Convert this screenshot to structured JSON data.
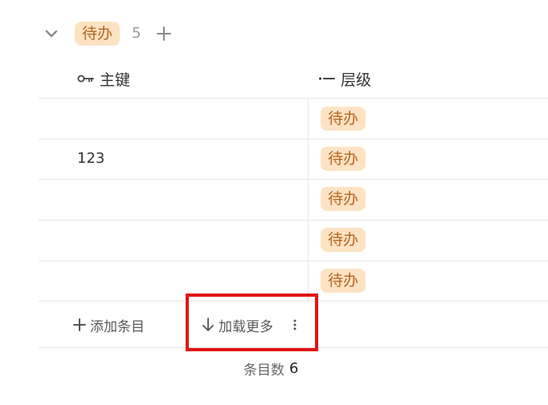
{
  "group": {
    "label": "待办",
    "count": "5"
  },
  "columns": {
    "key": "主键",
    "level": "层级"
  },
  "rows": [
    {
      "key": "",
      "level": "待办"
    },
    {
      "key": "123",
      "level": "待办"
    },
    {
      "key": "",
      "level": "待办"
    },
    {
      "key": "",
      "level": "待办"
    },
    {
      "key": "",
      "level": "待办"
    }
  ],
  "footer": {
    "add_entry": "添加条目",
    "load_more": "加载更多"
  },
  "summary": {
    "label": "条目数",
    "value": "6"
  },
  "colors": {
    "tag_bg": "#fde3c4",
    "tag_text": "#b5651d",
    "highlight": "#e11414"
  }
}
